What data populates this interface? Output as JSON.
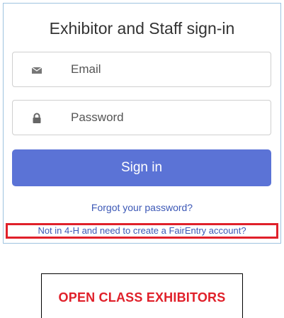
{
  "signin_panel": {
    "title": "Exhibitor and Staff sign-in",
    "email_placeholder": "Email",
    "email_icon": "envelope-icon",
    "password_placeholder": "Password",
    "password_icon": "lock-icon",
    "signin_label": "Sign in",
    "forgot_link": "Forgot your password?",
    "create_account_link": "Not in 4-H and need to create a FairEntry account?"
  },
  "open_class_box": {
    "label": "OPEN CLASS EXHIBITORS"
  },
  "colors": {
    "accent_button": "#5b73d6",
    "link": "#3c58b6",
    "highlight_border": "#e0202a",
    "open_class_text": "#e0202a"
  }
}
